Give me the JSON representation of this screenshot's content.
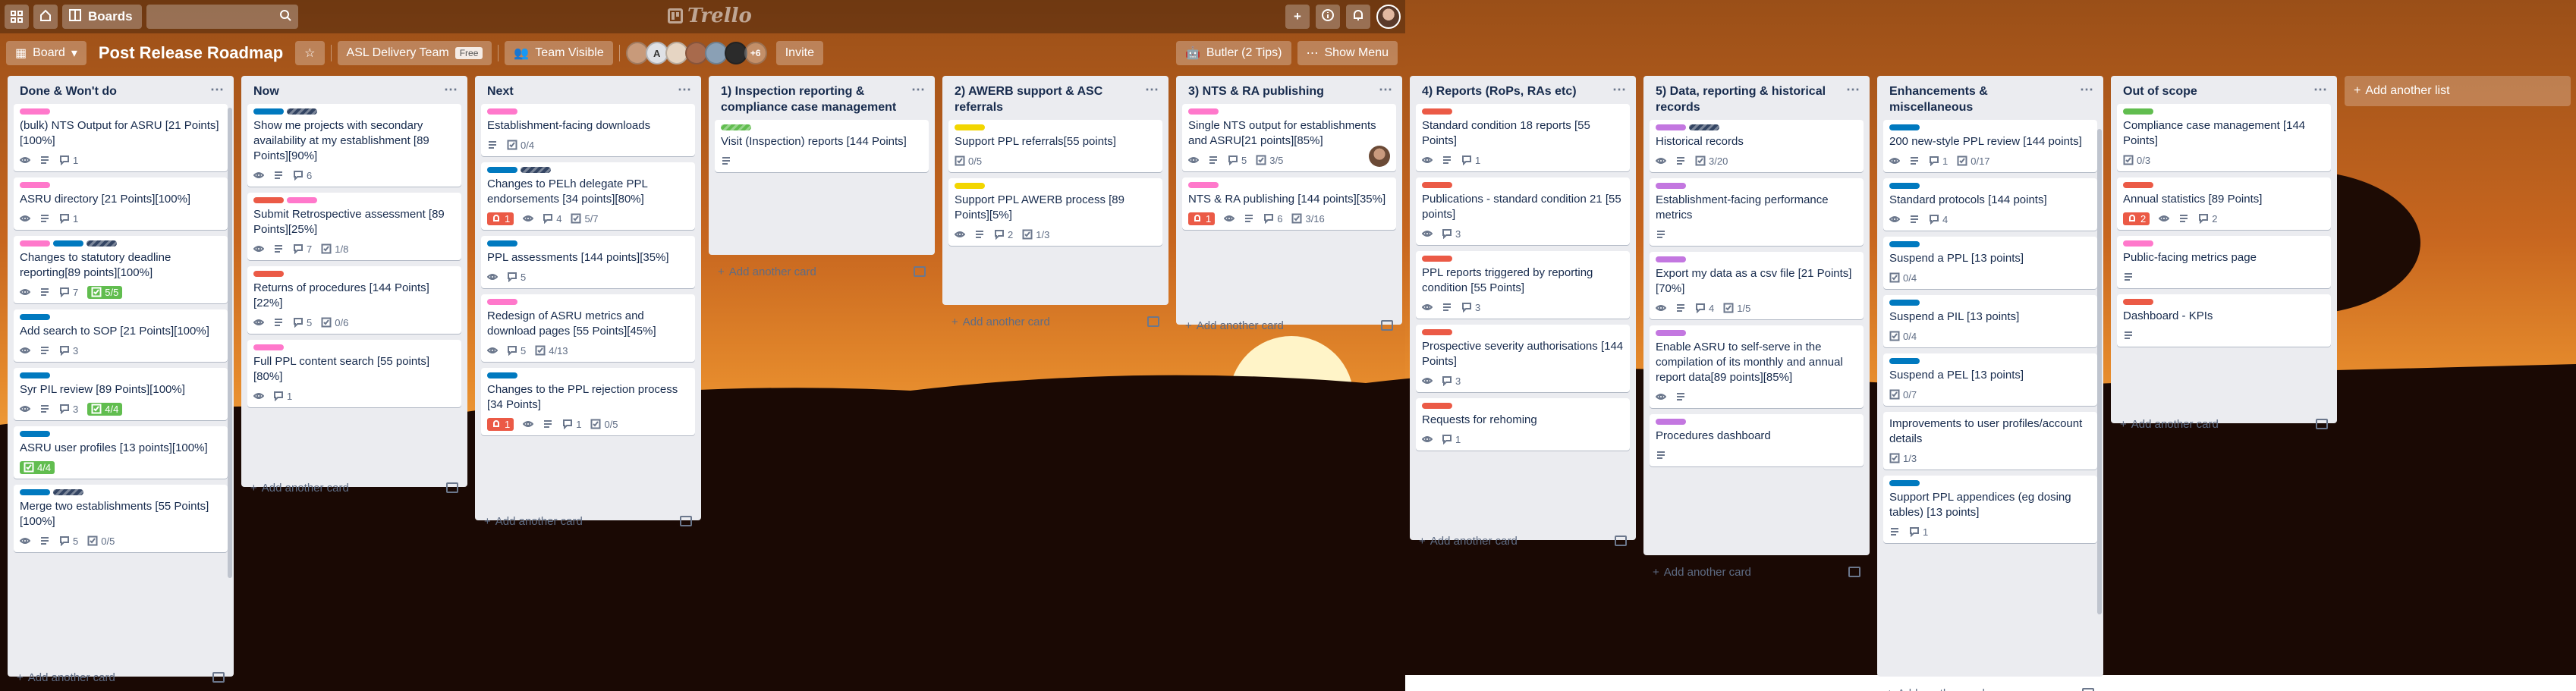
{
  "header": {
    "home_icon": "home-icon",
    "boards_label": "Boards",
    "search_placeholder": "",
    "logo_text": "Trello",
    "icons": [
      "plus-icon",
      "info-icon",
      "bell-icon"
    ]
  },
  "board": {
    "menu_label": "Board",
    "title": "Post Release Roadmap",
    "team_label": "ASL Delivery Team",
    "team_badge": "Free",
    "visibility_label": "Team Visible",
    "members_more": "+6",
    "invite_label": "Invite",
    "butler_label": "Butler (2 Tips)",
    "show_menu_label": "Show Menu"
  },
  "colors": {
    "pink": "#ff78cb",
    "blue": "#0079bf",
    "navy": "#344563",
    "red": "#eb5a46",
    "yellow": "#f2d600",
    "green": "#61bd4f",
    "purple": "#c377e0"
  },
  "footer_label": "Add another card",
  "add_list_label": "Add another list",
  "lists": [
    {
      "title": "Done & Won't do",
      "cards": [
        {
          "labels": [
            "pink"
          ],
          "title": "(bulk) NTS Output for ASRU [21 Points][100%]",
          "badges": [
            {
              "t": "eye"
            },
            {
              "t": "desc"
            },
            {
              "t": "comment",
              "v": "1"
            }
          ]
        },
        {
          "labels": [
            "pink"
          ],
          "title": "ASRU directory [21 Points][100%]",
          "badges": [
            {
              "t": "eye"
            },
            {
              "t": "desc"
            },
            {
              "t": "comment",
              "v": "1"
            }
          ]
        },
        {
          "labels": [
            "pink",
            "blue",
            "navy-s"
          ],
          "title": "Changes to statutory deadline reporting[89 points][100%]",
          "badges": [
            {
              "t": "eye"
            },
            {
              "t": "desc"
            },
            {
              "t": "comment",
              "v": "7"
            },
            {
              "t": "done",
              "v": "5/5"
            }
          ]
        },
        {
          "labels": [
            "blue"
          ],
          "title": "Add search to SOP [21 Points][100%]",
          "badges": [
            {
              "t": "eye"
            },
            {
              "t": "desc"
            },
            {
              "t": "comment",
              "v": "3"
            }
          ]
        },
        {
          "labels": [
            "blue"
          ],
          "title": "Syr PIL review [89 Points][100%]",
          "badges": [
            {
              "t": "eye"
            },
            {
              "t": "desc"
            },
            {
              "t": "comment",
              "v": "3"
            },
            {
              "t": "done",
              "v": "4/4"
            }
          ]
        },
        {
          "labels": [
            "blue"
          ],
          "title": "ASRU user profiles [13 points][100%]",
          "badges": [
            {
              "t": "done",
              "v": "4/4"
            }
          ]
        },
        {
          "labels": [
            "blue",
            "navy-s"
          ],
          "title": "Merge two establishments [55 Points][100%]",
          "badges": [
            {
              "t": "eye"
            },
            {
              "t": "desc"
            },
            {
              "t": "comment",
              "v": "5"
            },
            {
              "t": "check",
              "v": "0/5"
            }
          ]
        }
      ]
    },
    {
      "title": "Now",
      "cards": [
        {
          "labels": [
            "blue",
            "navy-s"
          ],
          "title": "Show me projects with secondary availability at my establishment [89 Points][90%]",
          "badges": [
            {
              "t": "eye"
            },
            {
              "t": "desc"
            },
            {
              "t": "comment",
              "v": "6"
            }
          ]
        },
        {
          "labels": [
            "red",
            "pink"
          ],
          "title": "Submit Retrospective assessment [89 Points][25%]",
          "badges": [
            {
              "t": "eye"
            },
            {
              "t": "desc"
            },
            {
              "t": "comment",
              "v": "7"
            },
            {
              "t": "check",
              "v": "1/8"
            }
          ]
        },
        {
          "labels": [
            "red"
          ],
          "title": "Returns of procedures [144 Points][22%]",
          "badges": [
            {
              "t": "eye"
            },
            {
              "t": "desc"
            },
            {
              "t": "comment",
              "v": "5"
            },
            {
              "t": "check",
              "v": "0/6"
            }
          ]
        },
        {
          "labels": [
            "pink"
          ],
          "title": "Full PPL content search [55 points][80%]",
          "badges": [
            {
              "t": "eye"
            },
            {
              "t": "comment",
              "v": "1"
            }
          ]
        }
      ]
    },
    {
      "title": "Next",
      "cards": [
        {
          "labels": [
            "pink"
          ],
          "title": "Establishment-facing downloads",
          "badges": [
            {
              "t": "desc"
            },
            {
              "t": "check",
              "v": "0/4"
            }
          ]
        },
        {
          "labels": [
            "blue",
            "navy-s"
          ],
          "title": "Changes to PELh delegate PPL endorsements [34 points][80%]",
          "badges": [
            {
              "t": "alert",
              "v": "1"
            },
            {
              "t": "eye"
            },
            {
              "t": "comment",
              "v": "4"
            },
            {
              "t": "check",
              "v": "5/7"
            }
          ]
        },
        {
          "labels": [
            "blue"
          ],
          "title": "PPL assessments [144 points][35%]",
          "badges": [
            {
              "t": "eye"
            },
            {
              "t": "comment",
              "v": "5"
            }
          ]
        },
        {
          "labels": [
            "pink"
          ],
          "title": "Redesign of ASRU metrics and download pages [55 Points][45%]",
          "badges": [
            {
              "t": "eye"
            },
            {
              "t": "comment",
              "v": "5"
            },
            {
              "t": "check",
              "v": "4/13"
            }
          ]
        },
        {
          "labels": [
            "blue"
          ],
          "title": "Changes to the PPL rejection process [34 Points]",
          "badges": [
            {
              "t": "alert",
              "v": "1"
            },
            {
              "t": "eye"
            },
            {
              "t": "desc"
            },
            {
              "t": "comment",
              "v": "1"
            },
            {
              "t": "check",
              "v": "0/5"
            }
          ]
        }
      ]
    },
    {
      "title": "1) Inspection reporting & compliance case management",
      "cards": [
        {
          "labels": [
            "green-s"
          ],
          "title": "Visit (Inspection) reports [144 Points]",
          "badges": [
            {
              "t": "desc"
            }
          ]
        }
      ]
    },
    {
      "title": "2) AWERB support & ASC referrals",
      "cards": [
        {
          "labels": [
            "yellow"
          ],
          "title": "Support PPL referrals[55 points]",
          "badges": [
            {
              "t": "check",
              "v": "0/5"
            }
          ]
        },
        {
          "labels": [
            "yellow"
          ],
          "title": "Support PPL AWERB process [89 Points][5%]",
          "badges": [
            {
              "t": "eye"
            },
            {
              "t": "desc"
            },
            {
              "t": "comment",
              "v": "2"
            },
            {
              "t": "check",
              "v": "1/3"
            }
          ]
        }
      ]
    },
    {
      "title": "3) NTS & RA publishing",
      "cards": [
        {
          "labels": [
            "pink"
          ],
          "title": "Single NTS output for establishments and ASRU[21 points][85%]",
          "badges": [
            {
              "t": "eye"
            },
            {
              "t": "desc"
            },
            {
              "t": "comment",
              "v": "5"
            },
            {
              "t": "check",
              "v": "3/5"
            }
          ],
          "avatar": true
        },
        {
          "labels": [
            "pink"
          ],
          "title": "NTS & RA publishing [144 points][35%]",
          "badges": [
            {
              "t": "alert",
              "v": "1"
            },
            {
              "t": "eye"
            },
            {
              "t": "desc"
            },
            {
              "t": "comment",
              "v": "6"
            },
            {
              "t": "check",
              "v": "3/16"
            }
          ]
        }
      ]
    },
    {
      "title": "4) Reports (RoPs, RAs etc)",
      "cards": [
        {
          "labels": [
            "red"
          ],
          "title": "Standard condition 18 reports [55 Points]",
          "badges": [
            {
              "t": "eye"
            },
            {
              "t": "desc"
            },
            {
              "t": "comment",
              "v": "1"
            }
          ]
        },
        {
          "labels": [
            "red"
          ],
          "title": "Publications - standard condition 21 [55 points]",
          "badges": [
            {
              "t": "eye"
            },
            {
              "t": "comment",
              "v": "3"
            }
          ]
        },
        {
          "labels": [
            "red"
          ],
          "title": "PPL reports triggered by reporting condition [55 Points]",
          "badges": [
            {
              "t": "eye"
            },
            {
              "t": "desc"
            },
            {
              "t": "comment",
              "v": "3"
            }
          ]
        },
        {
          "labels": [
            "red"
          ],
          "title": "Prospective severity authorisations [144 Points]",
          "badges": [
            {
              "t": "eye"
            },
            {
              "t": "comment",
              "v": "3"
            }
          ]
        },
        {
          "labels": [
            "red"
          ],
          "title": "Requests for rehoming",
          "badges": [
            {
              "t": "eye"
            },
            {
              "t": "comment",
              "v": "1"
            }
          ]
        }
      ]
    },
    {
      "title": "5) Data, reporting & historical records",
      "cards": [
        {
          "labels": [
            "purple",
            "navy-s"
          ],
          "title": "Historical records",
          "badges": [
            {
              "t": "eye"
            },
            {
              "t": "desc"
            },
            {
              "t": "check",
              "v": "3/20"
            }
          ]
        },
        {
          "labels": [
            "purple"
          ],
          "title": "Establishment-facing performance metrics",
          "badges": [
            {
              "t": "desc"
            }
          ]
        },
        {
          "labels": [
            "purple"
          ],
          "title": "Export my data as a csv file [21 Points][70%]",
          "badges": [
            {
              "t": "eye"
            },
            {
              "t": "desc"
            },
            {
              "t": "comment",
              "v": "4"
            },
            {
              "t": "check",
              "v": "1/5"
            }
          ]
        },
        {
          "labels": [
            "purple"
          ],
          "title": "Enable ASRU to self-serve in the compilation of its monthly and annual report data[89 points][85%]",
          "badges": [
            {
              "t": "eye"
            },
            {
              "t": "desc"
            }
          ]
        },
        {
          "labels": [
            "purple"
          ],
          "title": "Procedures dashboard",
          "badges": [
            {
              "t": "desc"
            }
          ]
        }
      ]
    },
    {
      "title": "Enhancements & miscellaneous",
      "cards": [
        {
          "labels": [
            "blue"
          ],
          "title": "200 new-style PPL review [144 points]",
          "badges": [
            {
              "t": "eye"
            },
            {
              "t": "desc"
            },
            {
              "t": "comment",
              "v": "1"
            },
            {
              "t": "check",
              "v": "0/17"
            }
          ]
        },
        {
          "labels": [
            "blue"
          ],
          "title": "Standard protocols [144 points]",
          "badges": [
            {
              "t": "eye"
            },
            {
              "t": "desc"
            },
            {
              "t": "comment",
              "v": "4"
            }
          ]
        },
        {
          "labels": [
            "blue"
          ],
          "title": "Suspend a PPL [13 points]",
          "badges": [
            {
              "t": "check",
              "v": "0/4"
            }
          ]
        },
        {
          "labels": [
            "blue"
          ],
          "title": "Suspend a PIL [13 points]",
          "badges": [
            {
              "t": "check",
              "v": "0/4"
            }
          ]
        },
        {
          "labels": [
            "blue"
          ],
          "title": "Suspend a PEL [13 points]",
          "badges": [
            {
              "t": "check",
              "v": "0/7"
            }
          ]
        },
        {
          "labels": [],
          "title": "Improvements to user profiles/account details",
          "badges": [
            {
              "t": "check",
              "v": "1/3"
            }
          ]
        },
        {
          "labels": [
            "blue"
          ],
          "title": "Support PPL appendices (eg dosing tables) [13 points]",
          "badges": [
            {
              "t": "desc"
            },
            {
              "t": "comment",
              "v": "1"
            }
          ]
        }
      ]
    },
    {
      "title": "Out of scope",
      "cards": [
        {
          "labels": [
            "green"
          ],
          "title": "Compliance case management [144 Points]",
          "badges": [
            {
              "t": "check",
              "v": "0/3"
            }
          ]
        },
        {
          "labels": [
            "red"
          ],
          "title": "Annual statistics [89 Points]",
          "badges": [
            {
              "t": "alert",
              "v": "2"
            },
            {
              "t": "eye"
            },
            {
              "t": "desc"
            },
            {
              "t": "comment",
              "v": "2"
            }
          ]
        },
        {
          "labels": [
            "pink"
          ],
          "title": "Public-facing metrics page",
          "badges": [
            {
              "t": "desc"
            }
          ]
        },
        {
          "labels": [
            "red"
          ],
          "title": "Dashboard - KPIs",
          "badges": [
            {
              "t": "desc"
            }
          ]
        }
      ]
    }
  ]
}
